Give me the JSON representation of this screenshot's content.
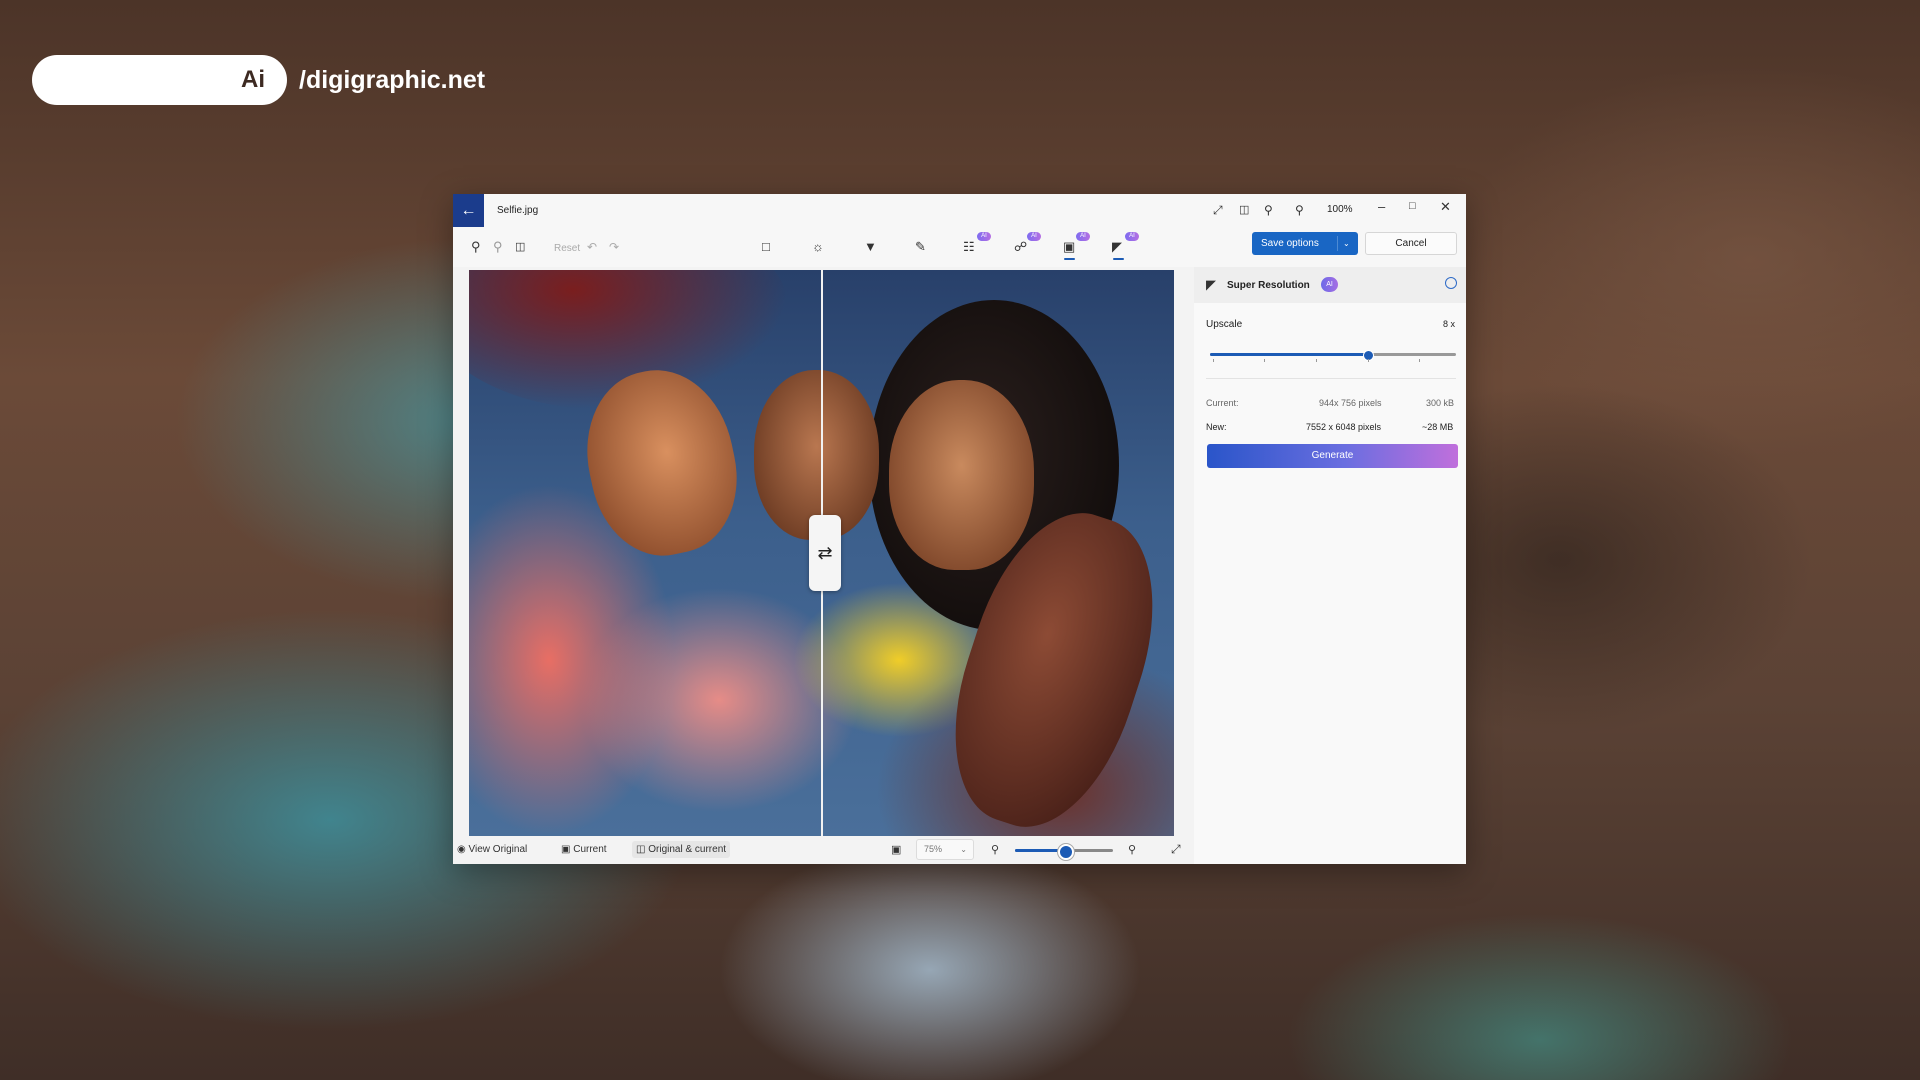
{
  "brand": {
    "pill_text": "Ai",
    "site": "/digigraphic.net"
  },
  "window": {
    "title": "Selfie.jpg",
    "zoom_label": "100%"
  },
  "toolbar": {
    "reset_label": "Reset",
    "ai_badge": "AI",
    "save_label": "Save options",
    "cancel_label": "Cancel"
  },
  "panel": {
    "title": "Super Resolution",
    "ai_badge": "AI",
    "upscale_label": "Upscale",
    "upscale_value": "8 x",
    "upscale_level_fraction": 0.64,
    "current_label": "Current:",
    "current_pixels": "944x 756 pixels",
    "current_size": "300 kB",
    "new_label": "New:",
    "new_pixels": "7552 x 6048 pixels",
    "new_size": "~28 MB",
    "generate_label": "Generate"
  },
  "bottom": {
    "view_original": "View Original",
    "current": "Current",
    "original_current": "Original & current",
    "zoom_value": "75%",
    "zoom_level_fraction": 0.5
  },
  "icons": {
    "back": "arrow-left-icon",
    "compare": "swap-arrows-icon"
  },
  "colors": {
    "accent": "#1966c4",
    "back_button": "#1b3c8c",
    "generate_gradient_start": "#2a55c9",
    "generate_gradient_end": "#c06fdc"
  }
}
